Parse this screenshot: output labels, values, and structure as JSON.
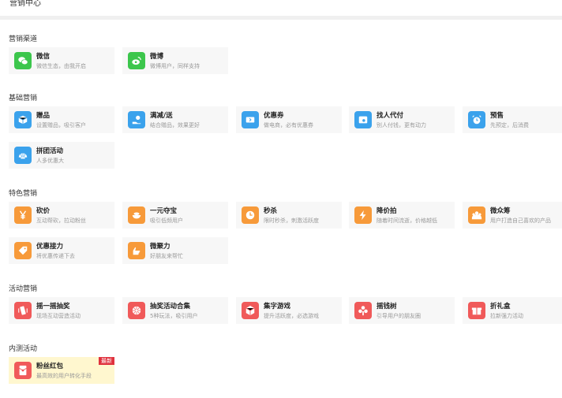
{
  "header": {
    "title": "营销中心"
  },
  "sections": [
    {
      "title": "营销渠道",
      "items": [
        {
          "name": "微信",
          "desc": "微信生态，由我开启",
          "icon": "wechat-icon",
          "color": "green"
        },
        {
          "name": "微博",
          "desc": "微博用户，同样支持",
          "icon": "weibo-icon",
          "color": "green"
        }
      ]
    },
    {
      "title": "基础营销",
      "items": [
        {
          "name": "赠品",
          "desc": "设置赠品，吸引客户",
          "icon": "gift-box-icon",
          "color": "blue"
        },
        {
          "name": "满减/送",
          "desc": "结合赠品，效果更好",
          "icon": "hand-coin-icon",
          "color": "blue"
        },
        {
          "name": "优惠券",
          "desc": "做电商，必有优惠券",
          "icon": "coupon-icon",
          "color": "blue"
        },
        {
          "name": "找人代付",
          "desc": "别人付钱，更有动力",
          "icon": "wallet-icon",
          "color": "blue"
        },
        {
          "name": "预售",
          "desc": "先预定，后消费",
          "icon": "alarm-clock-icon",
          "color": "blue"
        },
        {
          "name": "拼团活动",
          "desc": "人多优惠大",
          "icon": "shell-icon",
          "color": "blue"
        }
      ]
    },
    {
      "title": "特色营销",
      "items": [
        {
          "name": "砍价",
          "desc": "互动帮砍，拉动粉丝",
          "icon": "yen-icon",
          "color": "orange"
        },
        {
          "name": "一元夺宝",
          "desc": "吸引低频用户",
          "icon": "treasure-bowl-icon",
          "color": "orange"
        },
        {
          "name": "秒杀",
          "desc": "限时秒杀，刺激活跃度",
          "icon": "clock-icon",
          "color": "orange"
        },
        {
          "name": "降价拍",
          "desc": "随着时间流逝，价格越低",
          "icon": "lightning-icon",
          "color": "orange"
        },
        {
          "name": "微众筹",
          "desc": "用户打造自己喜欢的产品",
          "icon": "crowdfunding-icon",
          "color": "orange"
        },
        {
          "name": "优惠接力",
          "desc": "将优惠传递下去",
          "icon": "tag-icon",
          "color": "orange"
        },
        {
          "name": "微聚力",
          "desc": "好朋友来帮忙",
          "icon": "hand-icon",
          "color": "orange"
        }
      ]
    },
    {
      "title": "活动营销",
      "items": [
        {
          "name": "摇一摇抽奖",
          "desc": "现场互动营造活动",
          "icon": "shake-phone-icon",
          "color": "red"
        },
        {
          "name": "抽奖活动合集",
          "desc": "5种玩法，吸引用户",
          "icon": "lottery-wheel-icon",
          "color": "red"
        },
        {
          "name": "集字游戏",
          "desc": "提升活跃度，必选游戏",
          "icon": "cube-icon",
          "color": "red"
        },
        {
          "name": "摇钱树",
          "desc": "引导用户的朋友圈",
          "icon": "money-tree-icon",
          "color": "red"
        },
        {
          "name": "折礼盒",
          "desc": "拉新强力活动",
          "icon": "gift-icon",
          "color": "red"
        }
      ]
    },
    {
      "title": "内测活动",
      "items": [
        {
          "name": "粉丝红包",
          "desc": "最高效的用户转化手段",
          "icon": "red-packet-icon",
          "color": "red",
          "badge": "最新"
        }
      ]
    }
  ]
}
